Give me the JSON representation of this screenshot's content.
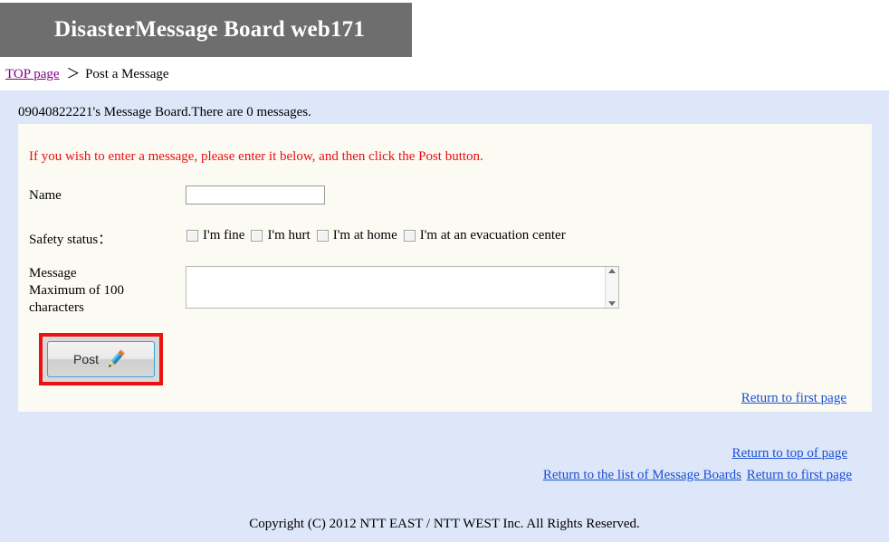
{
  "header": {
    "title": "DisasterMessage Board web171"
  },
  "breadcrumb": {
    "top_page_link": "TOP page",
    "separator": "＞",
    "current": "Post a Message"
  },
  "board": {
    "status": "09040822221's Message Board.There are 0 messages."
  },
  "form": {
    "notice": "If you wish to enter a message, please enter it below, and then click the Post button.",
    "name_label": "Name",
    "name_value": "",
    "name_placeholder": "",
    "safety_label": "Safety status：",
    "safety_options": [
      {
        "label": "I'm fine",
        "checked": false
      },
      {
        "label": "I'm hurt",
        "checked": false
      },
      {
        "label": "I'm at home",
        "checked": false
      },
      {
        "label": "I'm at an evacuation center",
        "checked": false
      }
    ],
    "message_label": "Message\nMaximum of 100 characters",
    "message_label_line1": "Message",
    "message_label_line2": "Maximum of 100",
    "message_label_line3": "characters",
    "message_value": "",
    "message_placeholder": "",
    "post_button_label": "Post",
    "post_button_icon": "pencil-icon",
    "post_button_highlight_color": "#ee1111"
  },
  "panel_links": {
    "return_first_page": "Return to first page"
  },
  "footer": {
    "return_top_of_page": "Return to top of page",
    "return_list_of_boards": "Return to the list of Message Boards",
    "return_first_page": "Return to first page",
    "copyright": "Copyright (C) 2012 NTT EAST / NTT WEST Inc. All Rights Reserved."
  },
  "colors": {
    "header_banner": "#6e6e6e",
    "page_blue": "#dde7f9",
    "panel_cream": "#fbfaf3",
    "notice_red": "#e81010",
    "link_blue": "#1a4fd6",
    "visited_link_purple": "#800080"
  }
}
